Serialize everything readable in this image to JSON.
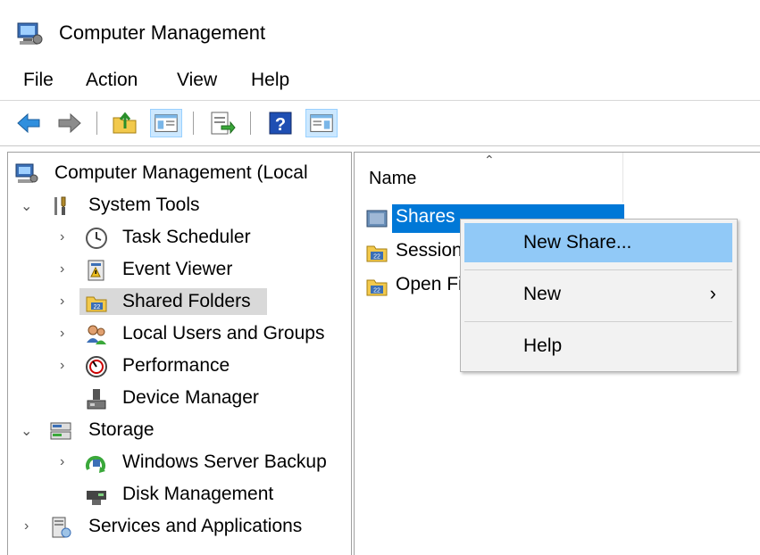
{
  "window": {
    "title": "Computer Management"
  },
  "menu": [
    "File",
    "Action",
    "View",
    "Help"
  ],
  "toolbar": {
    "buttons": [
      "back-icon",
      "forward-icon",
      "up-folder-icon",
      "show-hide-tree-icon",
      "export-list-icon",
      "help-icon",
      "show-hide-action-pane-icon"
    ]
  },
  "tree": {
    "items": [
      {
        "label": "Computer Management (Local",
        "icon": "computer-management-icon",
        "level": 0,
        "toggle": ""
      },
      {
        "label": "System Tools",
        "icon": "system-tools-icon",
        "level": 1,
        "toggle": "expanded"
      },
      {
        "label": "Task Scheduler",
        "icon": "clock-icon",
        "level": 2,
        "toggle": "collapsed"
      },
      {
        "label": "Event Viewer",
        "icon": "event-viewer-icon",
        "level": 2,
        "toggle": "collapsed"
      },
      {
        "label": "Shared Folders",
        "icon": "shared-folder-icon",
        "level": 2,
        "toggle": "collapsed",
        "selected": true
      },
      {
        "label": "Local Users and Groups",
        "icon": "users-icon",
        "level": 2,
        "toggle": "collapsed"
      },
      {
        "label": "Performance",
        "icon": "performance-icon",
        "level": 2,
        "toggle": "collapsed"
      },
      {
        "label": "Device Manager",
        "icon": "device-manager-icon",
        "level": 2,
        "toggle": ""
      },
      {
        "label": "Storage",
        "icon": "storage-icon",
        "level": 1,
        "toggle": "expanded"
      },
      {
        "label": "Windows Server Backup",
        "icon": "backup-icon",
        "level": 2,
        "toggle": "collapsed"
      },
      {
        "label": "Disk Management",
        "icon": "disk-icon",
        "level": 2,
        "toggle": ""
      },
      {
        "label": "Services and Applications",
        "icon": "services-icon",
        "level": 1,
        "toggle": "collapsed"
      }
    ]
  },
  "list": {
    "column": "Name",
    "rows": [
      {
        "label": "Shares",
        "icon": "shares-icon",
        "selected": true
      },
      {
        "label": "Sessions",
        "icon": "sessions-icon"
      },
      {
        "label": "Open Files",
        "icon": "open-files-icon"
      }
    ]
  },
  "context_menu": {
    "items": [
      {
        "label": "New Share...",
        "highlighted": true
      },
      {
        "label": "New",
        "submenu": true
      },
      {
        "label": "Help"
      }
    ]
  },
  "colors": {
    "selection": "#0078d7",
    "menu_highlight": "#91c9f7",
    "tree_selected": "#d9d9d9"
  }
}
